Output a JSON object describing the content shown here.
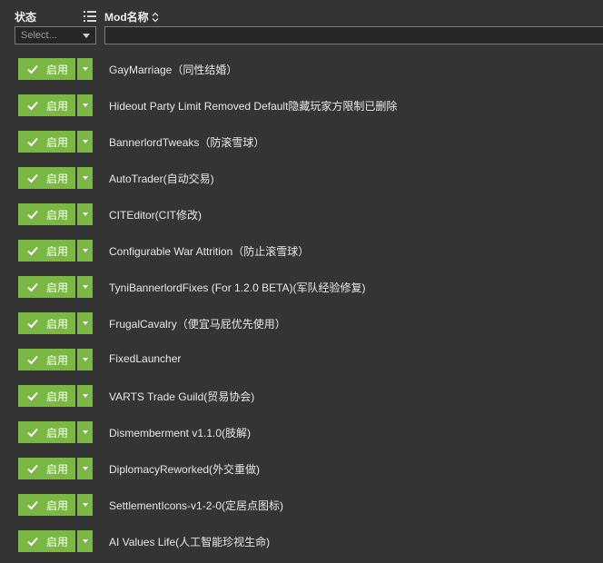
{
  "header": {
    "status_label": "状态",
    "mod_name_label": "Mod名称",
    "status_filter_placeholder": "Select...",
    "name_filter_value": ""
  },
  "colors": {
    "background": "#343434",
    "enable_green": "#7ab843",
    "input_bg": "#262626"
  },
  "mods": [
    {
      "status": "启用",
      "name": "GayMarriage（同性结婚）"
    },
    {
      "status": "启用",
      "name": "Hideout Party Limit Removed Default隐藏玩家方限制已删除"
    },
    {
      "status": "启用",
      "name": "BannerlordTweaks（防滚雪球）"
    },
    {
      "status": "启用",
      "name": "AutoTrader(自动交易)"
    },
    {
      "status": "启用",
      "name": "CITEditor(CIT修改)"
    },
    {
      "status": "启用",
      "name": "Configurable War Attrition（防止滚雪球）"
    },
    {
      "status": "启用",
      "name": "TyniBannerlordFixes (For 1.2.0 BETA)(军队经验修复)"
    },
    {
      "status": "启用",
      "name": "FrugalCavalry（便宜马屁优先使用）"
    },
    {
      "status": "启用",
      "name": "FixedLauncher"
    },
    {
      "status": "启用",
      "name": "VARTS Trade Guild(贸易协会)"
    },
    {
      "status": "启用",
      "name": "Dismemberment v1.1.0(肢解)"
    },
    {
      "status": "启用",
      "name": "DiplomacyReworked(外交重做)"
    },
    {
      "status": "启用",
      "name": "SettlementIcons-v1-2-0(定居点图标)"
    },
    {
      "status": "启用",
      "name": "AI Values Life(人工智能珍视生命)"
    }
  ]
}
